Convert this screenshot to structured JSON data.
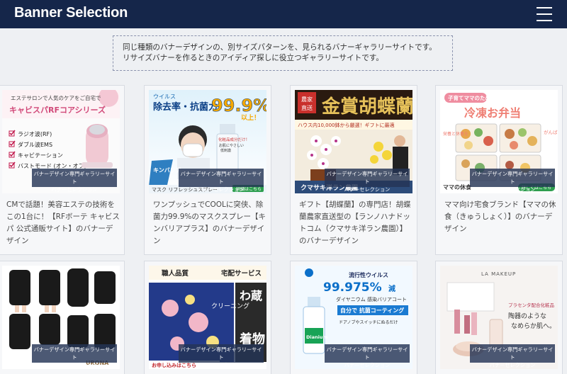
{
  "header": {
    "title": "Banner Selection",
    "menu_icon": "hamburger-icon"
  },
  "intro": {
    "line1": "同じ種類のバナーデザインの、別サイズパターンを、見られるバナーギャラリーサイトです。",
    "line2": "リサイズバナーを作るときのアイディア探しに役立つギャラリーサイトです。"
  },
  "overlay": {
    "line1": "バナーデザイン専門ギャラリーサイト",
    "line2": "バナーセレクション"
  },
  "cards": [
    {
      "caption": "CMで話題！美容エステの技術をこの1台に！【RFボーテ キャビスパ 公式通販サイト】のバナーデザイン",
      "banner": {
        "headline_top": "エステサロンで人気のケアをご自宅で",
        "headline": "キャビスパRFコアシリーズ",
        "features": [
          "ラジオ波(RF)",
          "ダブル波EMS",
          "キャビテーション",
          "バストモード (オン・オフ)"
        ]
      }
    },
    {
      "caption": "ワンプッシュでCOOLに突侠、除菌力99.9%のマスクスプレー【キンバリアプラス】のバナーデザイン",
      "banner": {
        "tag": "ウイルス",
        "headline": "除去率・抗菌力",
        "percent": "99.9%",
        "percent_suffix": "以上！",
        "bottle_text": "化粧品成分だけ！",
        "bottle_sub1": "お肌にやさしい",
        "bottle_sub2": "低刺激",
        "product": "キンバリア",
        "footer": "マスク リフレッシュスプレー",
        "cta": "詳細はこちら"
      }
    },
    {
      "caption": "ギフト【胡蝶蘭】の専門店！胡蝶蘭農家直送型の【ランノハナドットコム（クマサキ洋ラン農園）】のバナーデザイン",
      "banner": {
        "badge_top": "農家",
        "badge_bottom": "直送",
        "headline": "金賞胡蝶蘭",
        "sub": "ハウス内10,000鉢から厳選！ギフトに最適",
        "footer": "クマサキ洋ラン農園"
      }
    },
    {
      "caption": "ママ向け宅食ブランド【ママの休食（きゅうしょく）】のバナーデザイン",
      "banner": {
        "tag": "子育てママのための",
        "headline": "冷凍お弁当",
        "side": "がんばりすぎずママ",
        "side2": "栄養と休養を",
        "brand": "ママの休食",
        "cta": "詳しくはこちら"
      }
    },
    {
      "caption": "",
      "banner": {
        "brand": "URONA"
      }
    },
    {
      "caption": "",
      "banner": {
        "top_left": "職人品質",
        "top_right": "宅配サービス",
        "vertical1": "わ蔵",
        "vertical2": "クリーニング",
        "vertical3": "着物",
        "cta": "お申し込みはこちら"
      }
    },
    {
      "caption": "",
      "banner": {
        "tag": "流行性ウイルス",
        "percent": "99.975%",
        "percent_suffix": "減",
        "product": "ダイヤニウム 感染バリアコート",
        "coating": "自分で 抗菌コーティング",
        "bottle": "Dianium",
        "sub": "ドアノブやスイッチにぬるだけ"
      }
    },
    {
      "caption": "",
      "banner": {
        "brand": "LA MAKEUP",
        "side1": "プラセンタ配合化粧品",
        "side2": "陶器のような",
        "side3": "なめらか肌へ。"
      }
    }
  ]
}
